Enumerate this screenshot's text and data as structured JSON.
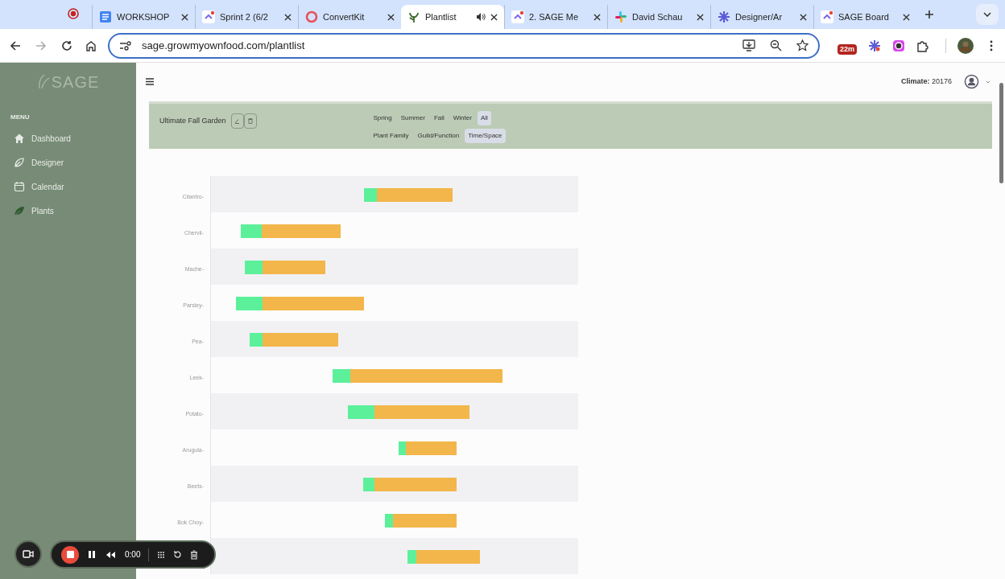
{
  "browser": {
    "tabs": [
      {
        "title": "WORKSHOP",
        "selected": false
      },
      {
        "title": "Sprint 2 (6/2",
        "selected": false
      },
      {
        "title": "ConvertKit",
        "selected": false
      },
      {
        "title": "Plantlist",
        "selected": true,
        "audio": true
      },
      {
        "title": "2. SAGE Me",
        "selected": false
      },
      {
        "title": "David Schau",
        "selected": false
      },
      {
        "title": "Designer/Ar",
        "selected": false
      },
      {
        "title": "SAGE Board",
        "selected": false
      }
    ],
    "url": "sage.growmyownfood.com/plantlist",
    "extension_badge": "22m"
  },
  "sidebar": {
    "logo": "SAGE",
    "menu_heading": "MENU",
    "items": [
      {
        "label": "Dashboard"
      },
      {
        "label": "Designer"
      },
      {
        "label": "Calendar"
      },
      {
        "label": "Plants"
      }
    ]
  },
  "header": {
    "climate_label": "Climate:",
    "climate_value": "20176"
  },
  "garden": {
    "name": "Ultimate Fall Garden",
    "seasons": [
      {
        "label": "Spring",
        "selected": false
      },
      {
        "label": "Summer",
        "selected": false
      },
      {
        "label": "Fall",
        "selected": false
      },
      {
        "label": "Winter",
        "selected": false
      },
      {
        "label": "All",
        "selected": true
      }
    ],
    "views": [
      {
        "label": "Plant Family",
        "selected": false
      },
      {
        "label": "Guild/Function",
        "selected": false
      },
      {
        "label": "Time/Space",
        "selected": true
      }
    ]
  },
  "timeline": {
    "rows": [
      {
        "label": "Cilantro-"
      },
      {
        "label": "Chervil-"
      },
      {
        "label": "Mache-"
      },
      {
        "label": "Parsley-"
      },
      {
        "label": "Pea-"
      },
      {
        "label": "Leek-"
      },
      {
        "label": "Potato-"
      },
      {
        "label": "Arugula-"
      },
      {
        "label": "Beets-"
      },
      {
        "label": "Bok Choy-"
      },
      {}
    ]
  },
  "recorder": {
    "time": "0:00"
  }
}
